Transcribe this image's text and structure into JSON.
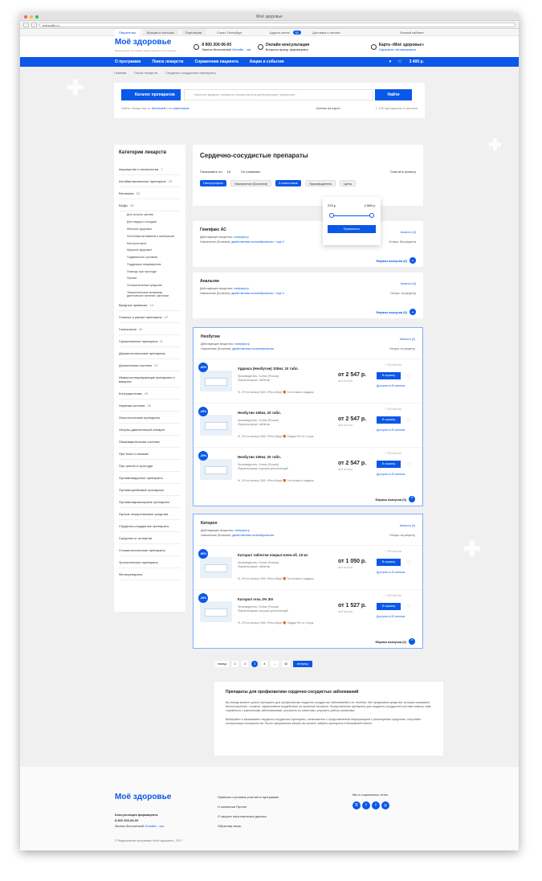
{
  "window": {
    "title": "Моё здоровье",
    "url": "myhealth.ru"
  },
  "topstrip": {
    "tabs": [
      "Пациентам",
      "Врачам и аптекам",
      "Партнерам"
    ],
    "city": "Санкт-Петербург",
    "addresses": "Адреса аптек",
    "addresses_count": "52",
    "delivery": "Доставка и оплата",
    "cabinet": "Личный кабинет"
  },
  "header": {
    "logo": "Моё здоровье",
    "tagline": "Федеральная программа лекарственного обеспечения",
    "phone": "8 800 200-06-00",
    "phone_note": "Звонок бесплатный",
    "online_chat": "Онлайн - чат",
    "consult_title": "Онлайн консультация",
    "consult_sub": "Вопросы врачу, фармацевту",
    "card_title": "Карта «Моё здоровье»",
    "card_get": "Оформить",
    "card_activate": "Активировать"
  },
  "nav": {
    "items": [
      "О программе",
      "Поиск лекарств",
      "Справочник пациента",
      "Акции и события"
    ],
    "cart_total": "3 400 р."
  },
  "breadcrumbs": [
    "Главная",
    "Поиск лекарств",
    "Сердечно-сосудистые препараты"
  ],
  "search": {
    "catalog_button": "Каталог препаратов",
    "placeholder": "Начните вводить название лекарства или действующего вещества...",
    "find_button": "Найти",
    "hint": "Найти лекарства от",
    "hint_link1": "болезней",
    "hint_or": "или",
    "hint_link2": "симптомов",
    "map": "Аптеки на карте",
    "count": "1 726 препаратов в системе"
  },
  "sidebar": {
    "title": "Категории лекарств",
    "items": [
      [
        "Акушерство и гинекология",
        "7"
      ],
      [
        "Антибактериальные препараты",
        "19"
      ],
      [
        "Витамины",
        "52"
      ],
      [
        "БАДы",
        "15"
      ]
    ],
    "subitems": [
      "Для острого зрения",
      "Для сердца и сосудов",
      "Женское здоровье",
      "Источники витаминов и минералов",
      "Контроль веса",
      "Мужское здоровье",
      "Подвижность суставов",
      "Поддержка пищеварения",
      "Помощь при простуде",
      "Прочие",
      "Успокоительные средства",
      "Энергетические витамины, диетическое питание, фитонии"
    ],
    "items2": [
      [
        "Вредные привычки",
        "14"
      ],
      [
        "Глазные и ушные препараты",
        "47"
      ],
      [
        "Гомеопатия",
        "31"
      ],
      [
        "Гормональные препараты",
        "8"
      ],
      [
        "Дерматологические препараты",
        ""
      ],
      [
        "Дыхательная система",
        "12"
      ],
      [
        "Иммуностимулирующие препараты и вакцины",
        ""
      ],
      [
        "Контрацептивы",
        "43"
      ],
      [
        "Нервная система",
        "26"
      ],
      [
        "Онкологические препараты",
        ""
      ],
      [
        "Опорно-двигательный аппарат",
        ""
      ],
      [
        "Пищеварительная система",
        ""
      ],
      [
        "При боли и спазмах",
        ""
      ],
      [
        "При гриппе и простуде",
        ""
      ],
      [
        "Противовирусные препараты",
        ""
      ],
      [
        "Противогрибковые препараты",
        ""
      ],
      [
        "Противопаразитарные препараты",
        ""
      ],
      [
        "Прочие лекарственные средства",
        ""
      ],
      [
        "Сердечно-сосудистые препараты",
        ""
      ],
      [
        "Средства от аллергии",
        ""
      ],
      [
        "Стоматологические препараты",
        ""
      ],
      [
        "Урологические препараты",
        ""
      ],
      [
        "Фитопрепараты",
        ""
      ]
    ]
  },
  "title_card": {
    "title": "Сердечно-сосудистые препараты",
    "show_by": "Показывать по:",
    "show_n": "18",
    "sort": "По названию",
    "clear": "Очистить фильтр",
    "chips": [
      "Гипертрофия",
      "Назначение (Болезни)",
      "6 симптомов",
      "Производитель",
      "Цена"
    ],
    "price_from": "225 р.",
    "price_to": "4 568 р.",
    "apply": "Применить"
  },
  "products": [
    {
      "name": "Гемпфакс АС",
      "subst_label": "Действующее вещество:",
      "subst": "гиперпрогр",
      "purpose_label": "Назначение (Болезни):",
      "purpose": "двойственная полинейропатия",
      "more": "+ еще 2",
      "analogs": "Аналоги (4)",
      "rx": "Отпуск: без рецепта",
      "forms": "Формы выпуска (3)"
    },
    {
      "name": "Анальгин",
      "subst_label": "Действующее вещество:",
      "subst": "гиперпрогр",
      "purpose_label": "Назначение (Болезни):",
      "purpose": "двойственная полинейропатия",
      "more": "+ еще 2",
      "analogs": "Аналоги (4)",
      "rx": "Отпуск: по рецепту",
      "forms": "Формы выпуска (3)"
    }
  ],
  "open1": {
    "name": "Необутин",
    "subst_label": "Действующее вещество:",
    "subst": "гиперпрогр",
    "purpose_label": "Назначение (Болезни):",
    "purpose": "двойственная полинейропатия",
    "analogs": "Аналоги (2)",
    "rx": "Отпуск: по рецепту",
    "forms": "Формы выпуска (3)",
    "offers": [
      {
        "badge": "-30%",
        "title": "Урдокса (Необутин) 100мг, 10 табл.",
        "m1": "Производитель: Сотекс (Россия)",
        "m2": "Форма выпуска: таблетки",
        "promo1": "-2% по полису ОМС «Ресо-Мед»",
        "promo2": "3 в полиса в подарок",
        "price": "от 2 547 р.",
        "price2": "за 6 из 8 уп.",
        "cart": "В корзину",
        "avail": "Доступно в 20 аптеках",
        "bonus": "+ 250 баллов"
      },
      {
        "badge": "-25%",
        "title": "Необутин 100мг, 20 табл.",
        "m1": "Производитель: Сотекс (Россия)",
        "m2": "Форма выпуска: таблетки",
        "promo1": "-2% по полису ОМС «Ресо-Мед»",
        "promo2": "Скидка 9% от 2 штук",
        "price": "от 2 547 р.",
        "price2": "за 6 из 8 уп.",
        "cart": "В корзину",
        "avail": "Доступно в 20 аптеках",
        "bonus": "+ 250 баллов"
      },
      {
        "badge": "-25%",
        "title": "Необутин 100мг, 20 табл.",
        "m1": "Производитель: Сотекс (Россия)",
        "m2": "Форма выпуска: порошок для инъекций",
        "promo1": "-2% по полису ОМС «Ресо-Мед»",
        "promo2": "3 в полиса в подарок",
        "price": "от 2 547 р.",
        "price2": "за 6 из 8 уп.",
        "cart": "В корзину",
        "avail": "Доступно в 20 аптеках",
        "bonus": "+ 250 баллов"
      }
    ]
  },
  "open2": {
    "name": "Каторол",
    "subst_label": "Действующее вещество:",
    "subst": "гиперпрогр",
    "purpose_label": "Назначение (Болезни):",
    "purpose": "двойственная полинейропатия",
    "analogs": "Аналоги (4)",
    "rx": "Отпуск: по рецепту",
    "forms": "Формы выпуска (2)",
    "offers": [
      {
        "badge": "-50%",
        "title": "Каторол таблетки покрыт.плен.об. 10 мг",
        "m1": "Производитель: Сотекс (Россия)",
        "m2": "Форма выпуска: таблетки",
        "promo1": "-2% по полису ОМС «Ресо-Мед»",
        "promo2": "3 в полиса в подарок",
        "price": "от 1 050 р.",
        "price2": "за 6 из 8 уп.",
        "cart": "В корзину",
        "avail": "Доступно в 20 аптеках",
        "bonus": "+ 250 баллов"
      },
      {
        "badge": "-25%",
        "title": "Каторол гель 2% 30г",
        "m1": "Производитель: Сотекс (Россия)",
        "m2": "Форма выпуска: порошок для инъекций",
        "promo1": "-2% по полису ОМС «Ресо-Мед»",
        "promo2": "Скидка 9% от 2 штук",
        "price": "от 1 527 р.",
        "price2": "за 6 из 8 уп.",
        "cart": "В корзину",
        "avail": "Доступно в 20 аптеках",
        "bonus": "+ 250 баллов"
      }
    ]
  },
  "pager": {
    "prev": "назад",
    "pages": [
      "1",
      "2",
      "3",
      "4",
      "...",
      "42"
    ],
    "current": "3",
    "next": "вперед"
  },
  "seo": {
    "title": "Препараты для профилактики сердечно-сосудистых заболеваний",
    "p1": "Вы всегда можете купить препараты для профилактики сердечно-сосудистых заболеваний и их лечения. Мы предлагаем средства, которые оказывают многостороннее, сложное, эффективное воздействие на организм человека. Лекарственные препараты для сердечно-сосудистой системы помогут вам справиться с различными заболеваниями, устранить их симптомы, улучшить работу организма.",
    "p2": "Выбирайте и заказывайте сердечно-сосудистые препараты, ознакомьтесь с представленной информацией о реализуемых средствах, получайте консультации специалистов. После оформления заказа, вы можете забрать препараты в ближайшей аптеке."
  },
  "footer": {
    "logo": "Моё здоровье",
    "consult": "Консультация фармацевта",
    "phone": "8 800 200-06-00",
    "free": "Звонок бесплатный",
    "chat": "Онлайн - чат",
    "links": [
      "Правила и условия участия в программе",
      "О компании Протек",
      "О защите персональных данных",
      "Обратная связь"
    ],
    "social_title": "Мы в социальных сетях",
    "social": [
      "В",
      "f",
      "f",
      "◎"
    ],
    "copy": "© Федеральная программа «Моё здоровье», 2017"
  }
}
